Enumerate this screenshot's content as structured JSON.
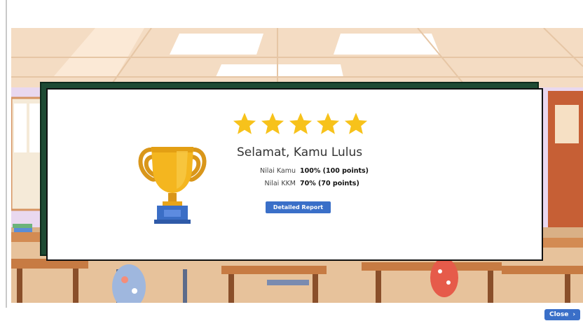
{
  "result": {
    "title": "Selamat, Kamu Lulus",
    "star_count": 5,
    "scores": [
      {
        "label": "Nilai Kamu",
        "value": "100% (100 points)"
      },
      {
        "label": "Nilai KKM",
        "value": "70% (70 points)"
      }
    ],
    "detail_button_label": "Detailed Report"
  },
  "footer": {
    "close_label": "Close",
    "close_icon": "chevron-right-icon"
  },
  "colors": {
    "star": "#f7c21b",
    "trophy": "#f2b01f",
    "trophy_base": "#3b6ec6",
    "button": "#3a6fc8",
    "board": "#1e4a33"
  }
}
